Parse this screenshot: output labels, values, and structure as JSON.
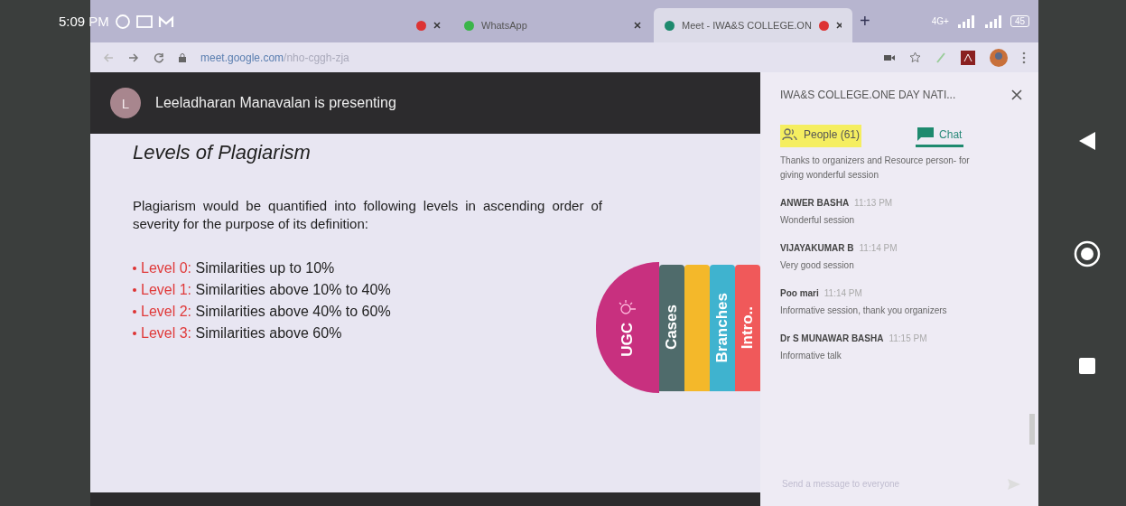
{
  "status_bar": {
    "time": "5:09 PM",
    "network": "4G+",
    "battery": "45"
  },
  "browser": {
    "tabs": [
      {
        "selected": false
      },
      {
        "title": "WhatsApp",
        "selected": false
      },
      {
        "title": "Meet - IWA&S COLLEGE.ON",
        "selected": true
      }
    ],
    "new_tab": "+",
    "url_host": "meet.google.com",
    "url_path": "/nho-cggh-zja"
  },
  "presentation": {
    "presenter_initial": "L",
    "banner": "Leeladharan Manavalan is presenting",
    "slide": {
      "title": "Levels of Plagiarism",
      "intro": "Plagiarism would be quantified into following levels in ascending order of severity for the purpose of its definition:",
      "levels": [
        {
          "label": "Level 0:",
          "text": "Similarities up to 10%"
        },
        {
          "label": "Level 1:",
          "text": "Similarities above 10% to 40%"
        },
        {
          "label": "Level 2:",
          "text": "Similarities above 40% to 60%"
        },
        {
          "label": "Level 3:",
          "text": "Similarities above 60%"
        }
      ],
      "section_tabs": [
        {
          "kind": "half-circle",
          "label": "UGC",
          "color": "#c8307f"
        },
        {
          "kind": "stripe",
          "label": "Cases",
          "color": "#4f6b6b"
        },
        {
          "kind": "stripe",
          "color": "#f4b82a"
        },
        {
          "kind": "stripe",
          "label": "Branches",
          "color": "#3fb3cf"
        },
        {
          "kind": "stripe",
          "label": "Intro..",
          "color": "#f0595a"
        }
      ]
    }
  },
  "chat_panel": {
    "title": "IWA&S COLLEGE.ONE DAY NATI...",
    "tabs": [
      {
        "label": "People (61)",
        "selected": false,
        "highlighted": true
      },
      {
        "label": "Chat",
        "selected": true,
        "highlighted": false
      }
    ],
    "messages": [
      {
        "text": "Thanks to organizers and Resource person- for giving wonderful session"
      },
      {
        "sender": "ANWER BASHA",
        "time": "11:13 PM",
        "text": "Wonderful session"
      },
      {
        "sender": "VIJAYAKUMAR B",
        "time": "11:14 PM",
        "text": "Very good session"
      },
      {
        "sender": "Poo mari",
        "time": "11:14 PM",
        "text": "Informative session, thank you organizers"
      },
      {
        "sender": "Dr S MUNAWAR BASHA",
        "time": "11:15 PM",
        "text": "Informative talk"
      }
    ],
    "input_placeholder": "Send a message to everyone"
  }
}
